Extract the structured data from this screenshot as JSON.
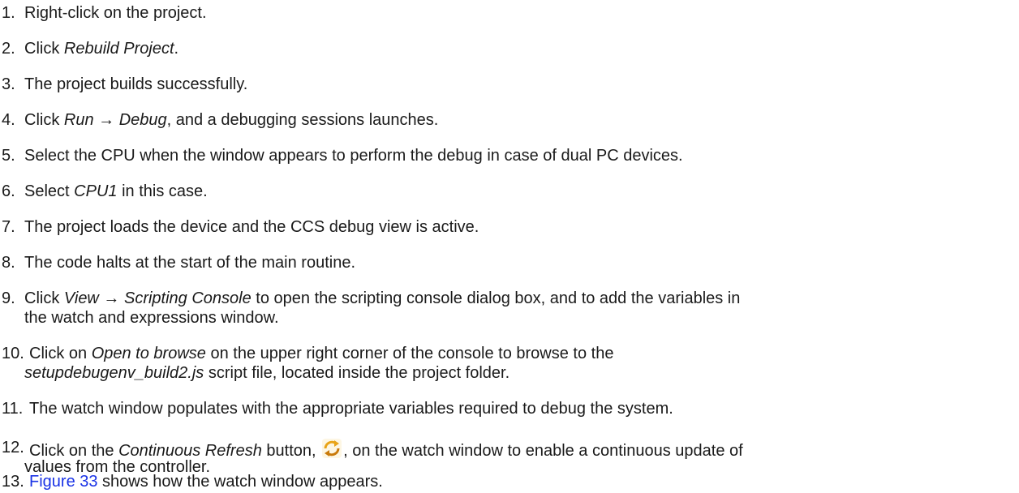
{
  "steps": [
    {
      "num": "1.",
      "a": "Right-click on the project."
    },
    {
      "num": "2.",
      "a": "Click ",
      "b": "Rebuild Project",
      "c": "."
    },
    {
      "num": "3.",
      "a": "The project builds successfully."
    },
    {
      "num": "4.",
      "a": "Click ",
      "b": "Run → Debug",
      "c": ", and a debugging sessions launches."
    },
    {
      "num": "5.",
      "a": "Select the CPU when the window appears to perform the debug in case of dual PC devices."
    },
    {
      "num": "6.",
      "a": "Select ",
      "b": "CPU1",
      "c": " in this case."
    },
    {
      "num": "7.",
      "a": "The project loads the device and the CCS debug view is active."
    },
    {
      "num": "8.",
      "a": "The code halts at the start of the main routine."
    },
    {
      "num": "9.",
      "a": "Click ",
      "b": "View → Scripting Console",
      "c": " to open the scripting console dialog box, and to add the variables in",
      "d": "the watch and expressions window."
    },
    {
      "num": "10.",
      "a": "Click on ",
      "b": "Open to browse",
      "c": " on the upper right corner of the console to browse to the",
      "d": "setupdebugenv_build2.js",
      "e": " script file, located inside the project folder."
    },
    {
      "num": "11.",
      "a": "The watch window populates with the appropriate variables required to debug the system."
    },
    {
      "num": "12.",
      "a": "Click on the ",
      "b": "Continuous Refresh",
      "c": " button, ",
      "c2": ", on the watch window to enable a continuous update of",
      "d": "values from the controller."
    },
    {
      "num": "13.",
      "link": "Figure 33",
      "a": " shows how the watch window appears."
    }
  ],
  "colors": {
    "text": "#1a1a1a",
    "link": "#1a33e6",
    "icon_primary": "#e8a317"
  }
}
